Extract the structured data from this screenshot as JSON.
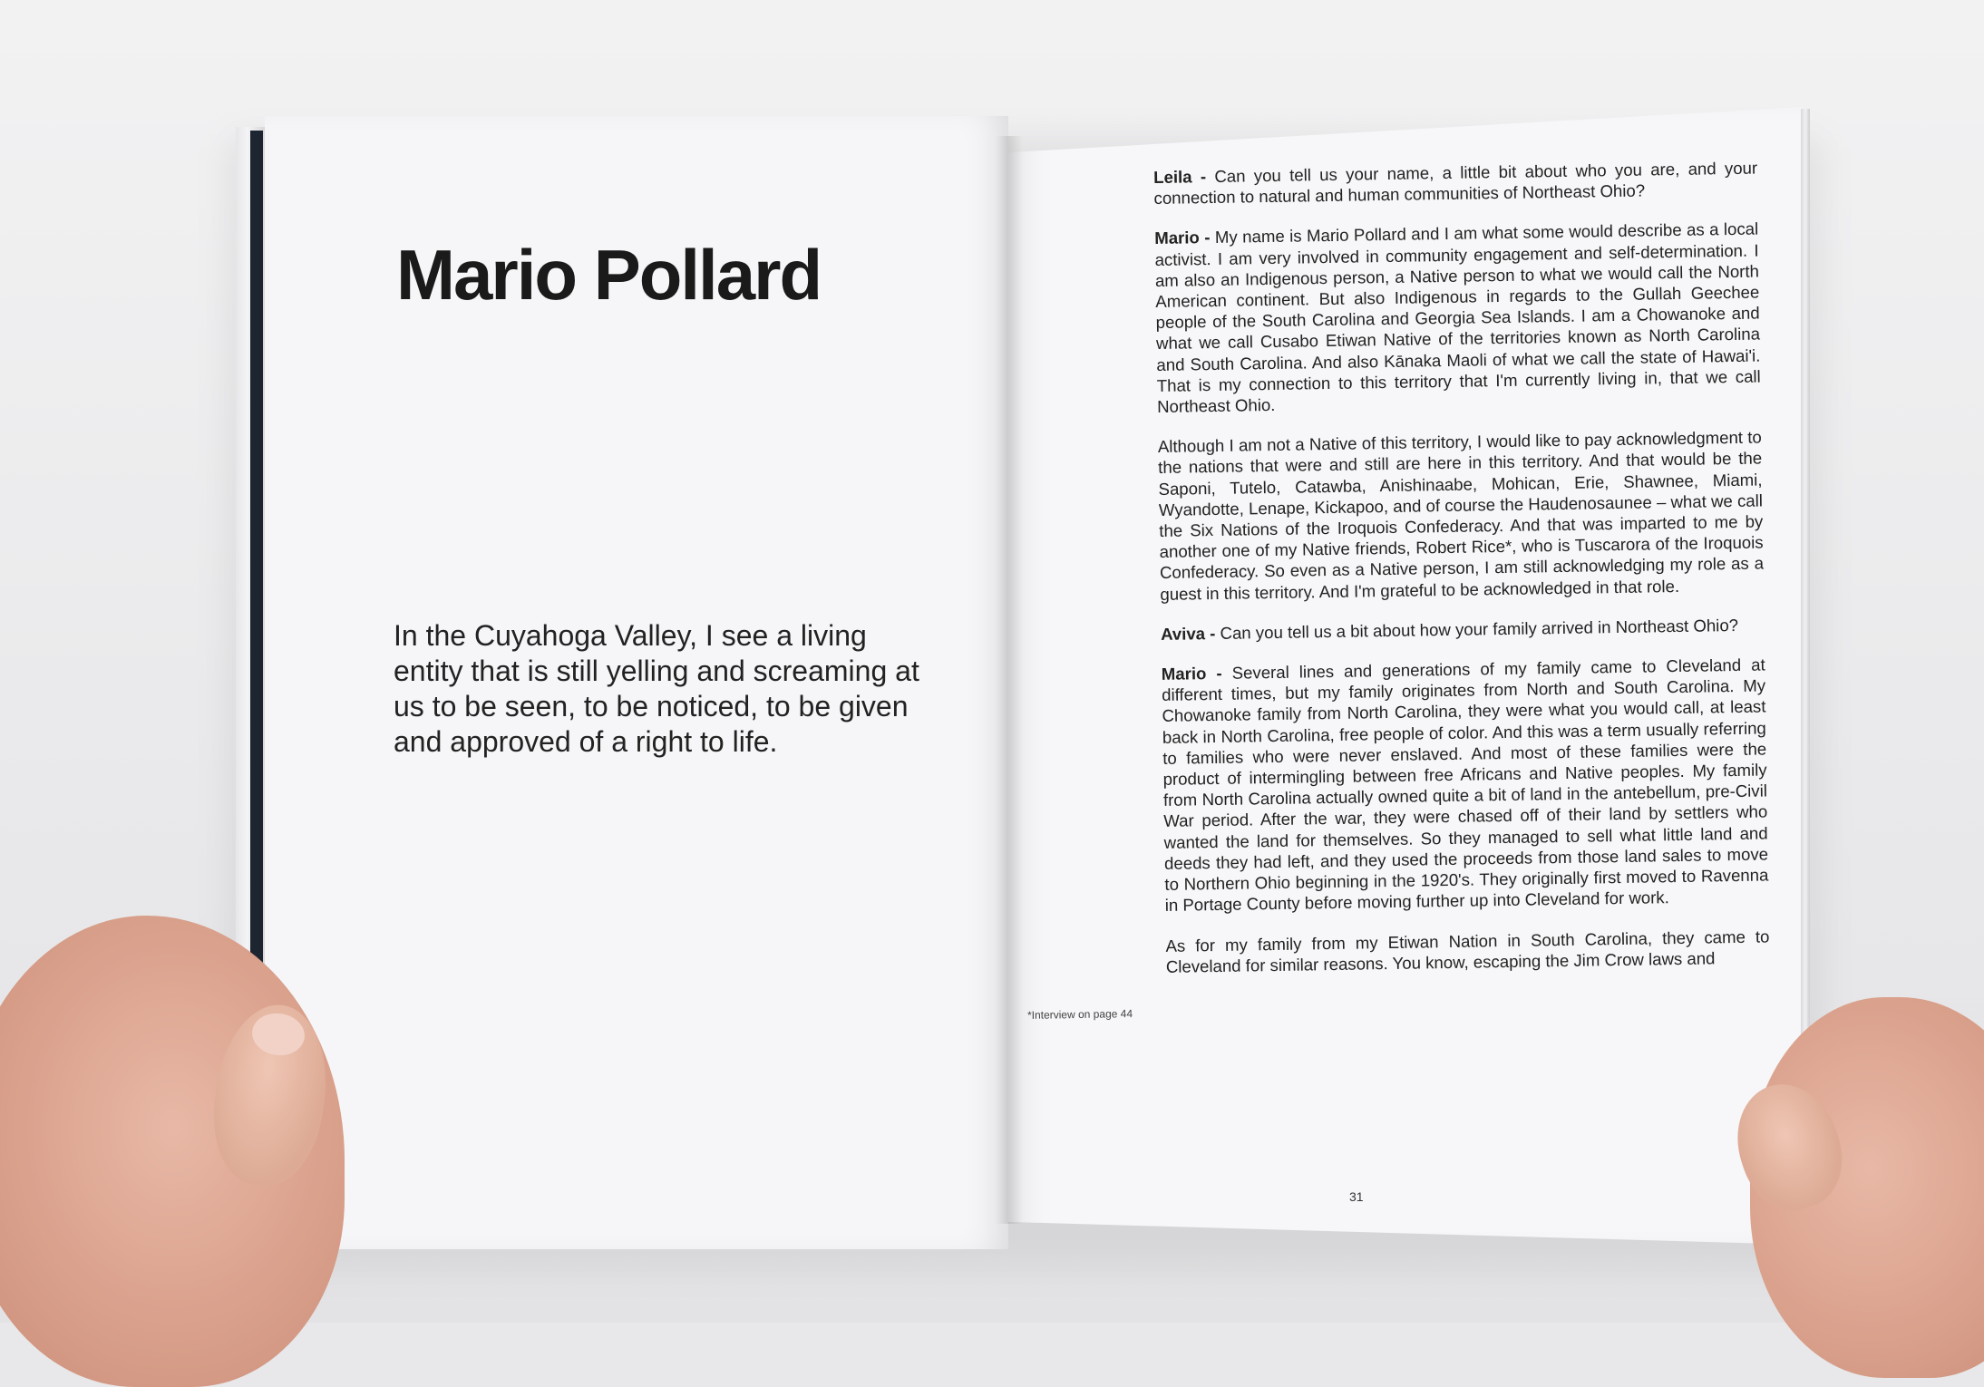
{
  "left_page": {
    "title": "Mario Pollard",
    "pull_quote": "In the Cuyahoga Valley, I see a living entity that is still yelling and screaming at us to be seen, to be noticed, to be given and approved of a right to life."
  },
  "right_page": {
    "paragraphs": [
      {
        "speaker": "Leila -",
        "text": "Can you tell us your name, a little bit about who you are, and your connection to natural and human communities of Northeast Ohio?"
      },
      {
        "speaker": "Mario -",
        "text": "My name is Mario Pollard and I am what some would describe as a local activist. I am very involved in community engagement and self-determination. I am also an Indigenous person, a Native person to what we would call the North American continent. But also Indigenous in regards to the Gullah Geechee people of the South Carolina and Georgia Sea Islands. I am a Chowanoke and what we call Cusabo Etiwan Native of the territories known as North Carolina and South Carolina. And also Kānaka Maoli of what we call the state of Hawai'i. That is my connection to this territory that I'm currently living in, that we call Northeast Ohio."
      },
      {
        "speaker": "",
        "text": "Although I am not a Native of this territory, I would like to pay acknowledgment to the nations that were and still are here in this territory. And that would be the Saponi, Tutelo, Catawba, Anishinaabe, Mohican, Erie, Shawnee, Miami, Wyandotte, Lenape, Kickapoo, and of course the Haudenosaunee – what we call the Six Nations of the Iroquois Confederacy. And that was imparted to me by another one of my Native friends, Robert Rice*, who is Tuscarora of the Iroquois Confederacy. So even as a Native person, I am still acknowledging my role as a guest in this territory. And I'm grateful to be acknowledged in that role."
      },
      {
        "speaker": "Aviva -",
        "text": "Can you tell us a bit about how your family arrived in Northeast Ohio?"
      },
      {
        "speaker": "Mario -",
        "text": "Several lines and generations of my family came to Cleveland at different times, but my family originates from North and South Carolina. My Chowanoke family from North Carolina, they were what you would call, at least back in North Carolina, free people of color. And this was a term usually referring to families who were never enslaved. And most of these families were the product of intermingling between free Africans and Native peoples. My family from North Carolina actually owned quite a bit of land in the antebellum, pre-Civil War period. After the war, they were chased off of their land by settlers who wanted the land for themselves. So they managed to sell what little land and deeds they had left, and they used the proceeds from those land sales to move to Northern Ohio beginning in the 1920's. They originally first moved to Ravenna in Portage County before moving further up into Cleveland for work."
      },
      {
        "speaker": "",
        "text": "As for my family from my Etiwan Nation in South Carolina, they came to Cleveland for similar reasons. You know, escaping the Jim Crow laws and"
      }
    ],
    "footnote": "*Interview on page 44",
    "page_number": "31"
  }
}
